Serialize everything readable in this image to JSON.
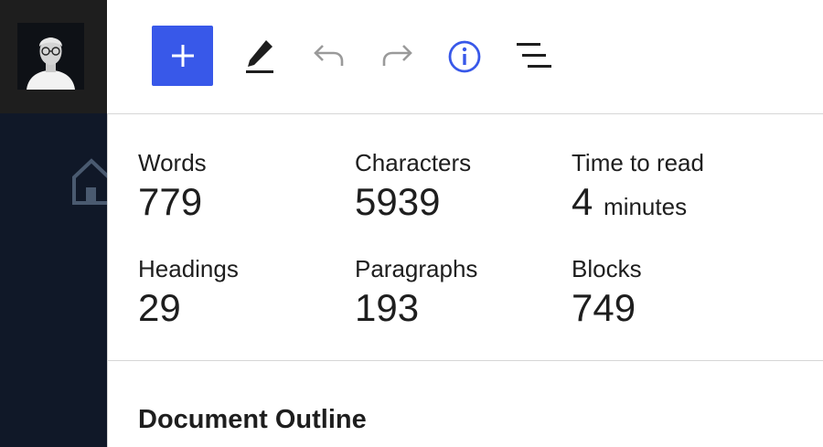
{
  "toolbar": {
    "add_icon": "plus-icon",
    "edit_icon": "pencil-icon",
    "undo_icon": "undo-icon",
    "redo_icon": "redo-icon",
    "info_icon": "info-icon",
    "outline_icon": "list-view-icon",
    "accent_color": "#3858e9"
  },
  "sidebar": {
    "avatar_icon": "user-avatar",
    "home_icon": "home-icon",
    "background": "#101828"
  },
  "stats": {
    "words": {
      "label": "Words",
      "value": "779"
    },
    "characters": {
      "label": "Characters",
      "value": "5939"
    },
    "time_to_read": {
      "label": "Time to read",
      "value": "4",
      "unit": "minutes"
    },
    "headings": {
      "label": "Headings",
      "value": "29"
    },
    "paragraphs": {
      "label": "Paragraphs",
      "value": "193"
    },
    "blocks": {
      "label": "Blocks",
      "value": "749"
    }
  },
  "outline": {
    "title": "Document Outline"
  }
}
